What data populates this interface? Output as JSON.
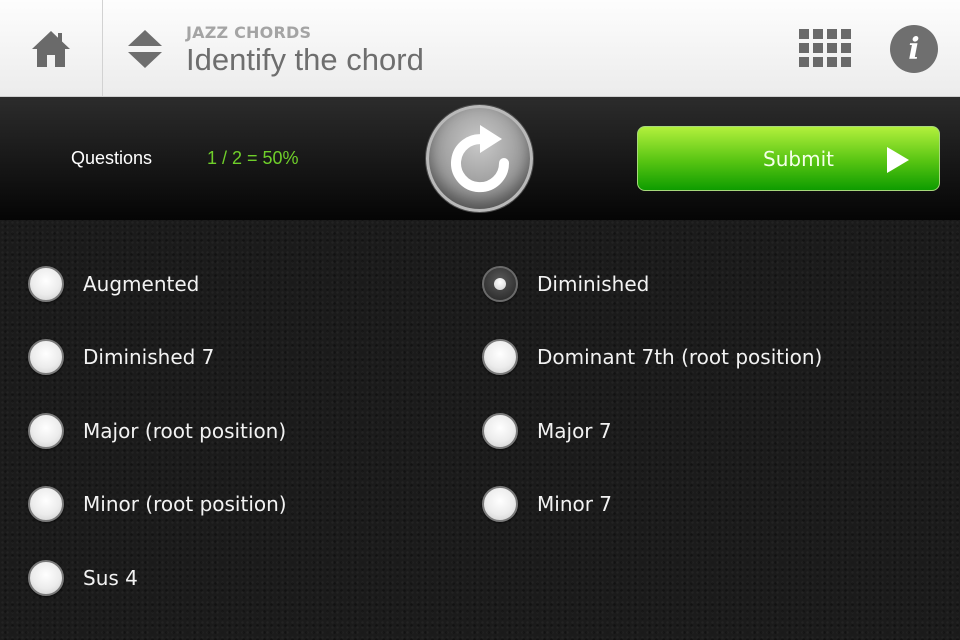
{
  "header": {
    "subtitle": "JAZZ CHORDS",
    "title": "Identify the chord",
    "icons": {
      "home": "home-icon",
      "updown": "sort-updown-icon",
      "grid": "grid-icon",
      "info": "info-icon"
    },
    "info_glyph": "i"
  },
  "toolbar": {
    "questions_label": "Questions",
    "score": "1 / 2 = 50%",
    "score_color": "#6fcf2a",
    "reload_icon": "reload-icon",
    "submit_label": "Submit",
    "submit_icon": "play-arrow-icon"
  },
  "options": {
    "selected": "Diminished",
    "items": [
      {
        "label": "Augmented",
        "checked": false
      },
      {
        "label": "Diminished",
        "checked": true
      },
      {
        "label": "Diminished 7",
        "checked": false
      },
      {
        "label": "Dominant 7th (root position)",
        "checked": false
      },
      {
        "label": "Major (root position)",
        "checked": false
      },
      {
        "label": "Major 7",
        "checked": false
      },
      {
        "label": "Minor (root position)",
        "checked": false
      },
      {
        "label": "Minor 7",
        "checked": false
      },
      {
        "label": "Sus 4",
        "checked": false
      }
    ]
  }
}
